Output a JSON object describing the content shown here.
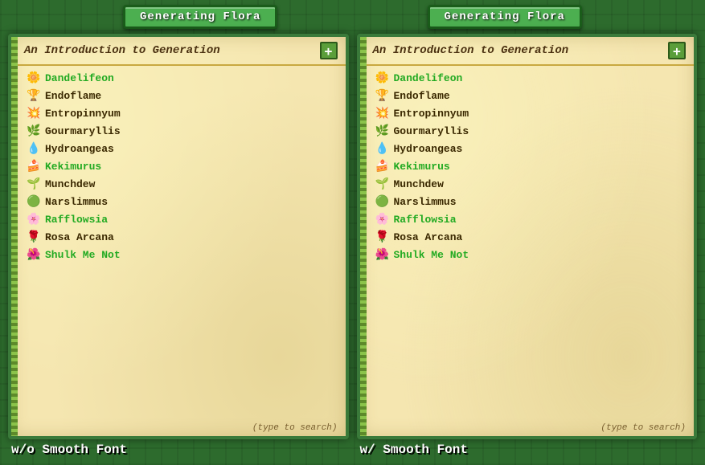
{
  "tabs": [
    {
      "label": "Generating Flora",
      "id": "left-tab"
    },
    {
      "label": "Generating Flora",
      "id": "right-tab"
    }
  ],
  "panels": [
    {
      "id": "left-panel",
      "title": "An Introduction to Generation",
      "plus_label": "+",
      "items": [
        {
          "id": "dandelifeon",
          "label": "Dandelifeon",
          "icon": "❋",
          "color": "green",
          "icon_class": "icon-dandelifeon"
        },
        {
          "id": "endoflame",
          "label": "Endoflame",
          "icon": "🏆",
          "color": "dark",
          "icon_class": "icon-endoflame"
        },
        {
          "id": "entropinnyum",
          "label": "Entropinnyum",
          "icon": "✿",
          "color": "dark",
          "icon_class": "icon-entropinnyum"
        },
        {
          "id": "gourmaryllis",
          "label": "Gourmaryllis",
          "icon": "❀",
          "color": "dark",
          "icon_class": "icon-gourmaryllis"
        },
        {
          "id": "hydroangeas",
          "label": "Hydroangeas",
          "icon": "❁",
          "color": "dark",
          "icon_class": "icon-hydroangeas"
        },
        {
          "id": "kekimurus",
          "label": "Kekimurus",
          "icon": "✾",
          "color": "green",
          "icon_class": "icon-kekimurus"
        },
        {
          "id": "munchdew",
          "label": "Munchdew",
          "icon": "✤",
          "color": "dark",
          "icon_class": "icon-munchdew"
        },
        {
          "id": "narslimmus",
          "label": "Narslimmus",
          "icon": "❉",
          "color": "dark",
          "icon_class": "icon-narslimmus"
        },
        {
          "id": "rafflowsia",
          "label": "Rafflowsia",
          "icon": "✽",
          "color": "green",
          "icon_class": "icon-rafflowsia"
        },
        {
          "id": "rosa",
          "label": "Rosa Arcana",
          "icon": "✿",
          "color": "dark",
          "icon_class": "icon-rosa"
        },
        {
          "id": "shulk",
          "label": "Shulk Me Not",
          "icon": "❃",
          "color": "green",
          "icon_class": "icon-shulk"
        }
      ],
      "search_hint": "(type to search)"
    },
    {
      "id": "right-panel",
      "title": "An Introduction to Generation",
      "plus_label": "+",
      "items": [
        {
          "id": "dandelifeon",
          "label": "Dandelifeon",
          "icon": "❋",
          "color": "green",
          "icon_class": "icon-dandelifeon"
        },
        {
          "id": "endoflame",
          "label": "Endoflame",
          "icon": "🏆",
          "color": "dark",
          "icon_class": "icon-endoflame"
        },
        {
          "id": "entropinnyum",
          "label": "Entropinnyum",
          "icon": "✿",
          "color": "dark",
          "icon_class": "icon-entropinnyum"
        },
        {
          "id": "gourmaryllis",
          "label": "Gourmaryllis",
          "icon": "❀",
          "color": "dark",
          "icon_class": "icon-gourmaryllis"
        },
        {
          "id": "hydroangeas",
          "label": "Hydroangeas",
          "icon": "❁",
          "color": "dark",
          "icon_class": "icon-hydroangeas"
        },
        {
          "id": "kekimurus",
          "label": "Kekimurus",
          "icon": "✾",
          "color": "green",
          "icon_class": "icon-kekimurus"
        },
        {
          "id": "munchdew",
          "label": "Munchdew",
          "icon": "✤",
          "color": "dark",
          "icon_class": "icon-munchdew"
        },
        {
          "id": "narslimmus",
          "label": "Narslimmus",
          "icon": "❉",
          "color": "dark",
          "icon_class": "icon-narslimmus"
        },
        {
          "id": "rafflowsia",
          "label": "Rafflowsia",
          "icon": "✽",
          "color": "green",
          "icon_class": "icon-rafflowsia"
        },
        {
          "id": "rosa",
          "label": "Rosa Arcana",
          "icon": "✿",
          "color": "dark",
          "icon_class": "icon-rosa"
        },
        {
          "id": "shulk",
          "label": "Shulk Me Not",
          "icon": "❃",
          "color": "green",
          "icon_class": "icon-shulk"
        }
      ],
      "search_hint": "(type to search)"
    }
  ],
  "bottom_labels": [
    {
      "id": "left-label",
      "text": "w/o Smooth Font"
    },
    {
      "id": "right-label",
      "text": "w/ Smooth Font"
    }
  ],
  "colors": {
    "bg": "#2d6b2d",
    "tab_bg": "#4caf50",
    "panel_bg": "#f5e6b0",
    "green_text": "#22aa22",
    "dark_text": "#3a2800"
  }
}
